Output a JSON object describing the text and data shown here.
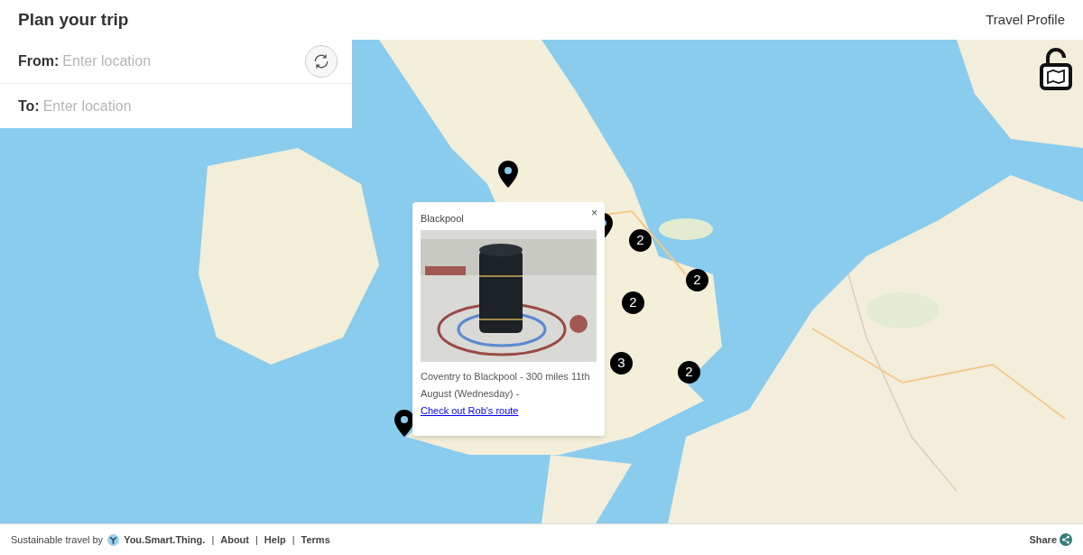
{
  "header": {
    "title": "Plan your trip",
    "profile_link": "Travel Profile"
  },
  "route_form": {
    "fields": [
      {
        "label": "From:",
        "placeholder": "Enter location"
      },
      {
        "label": "To:",
        "placeholder": "Enter location"
      }
    ]
  },
  "map": {
    "kind": "picture",
    "clusters": [
      {
        "count": "2"
      },
      {
        "count": "2"
      },
      {
        "count": "2"
      },
      {
        "count": "3"
      },
      {
        "count": "2"
      }
    ],
    "popup": {
      "title": "Blackpool",
      "close": "×",
      "text": "Coventry to Blackpool - 300 miles 11th August (Wednesday) - ",
      "link": "Check out Rob's route"
    }
  },
  "footer": {
    "credit": "Sustainable travel by",
    "brand": "You.Smart.Thing.",
    "separator": "|",
    "links": [
      "About",
      "Help",
      "Terms"
    ],
    "share": "Share"
  }
}
